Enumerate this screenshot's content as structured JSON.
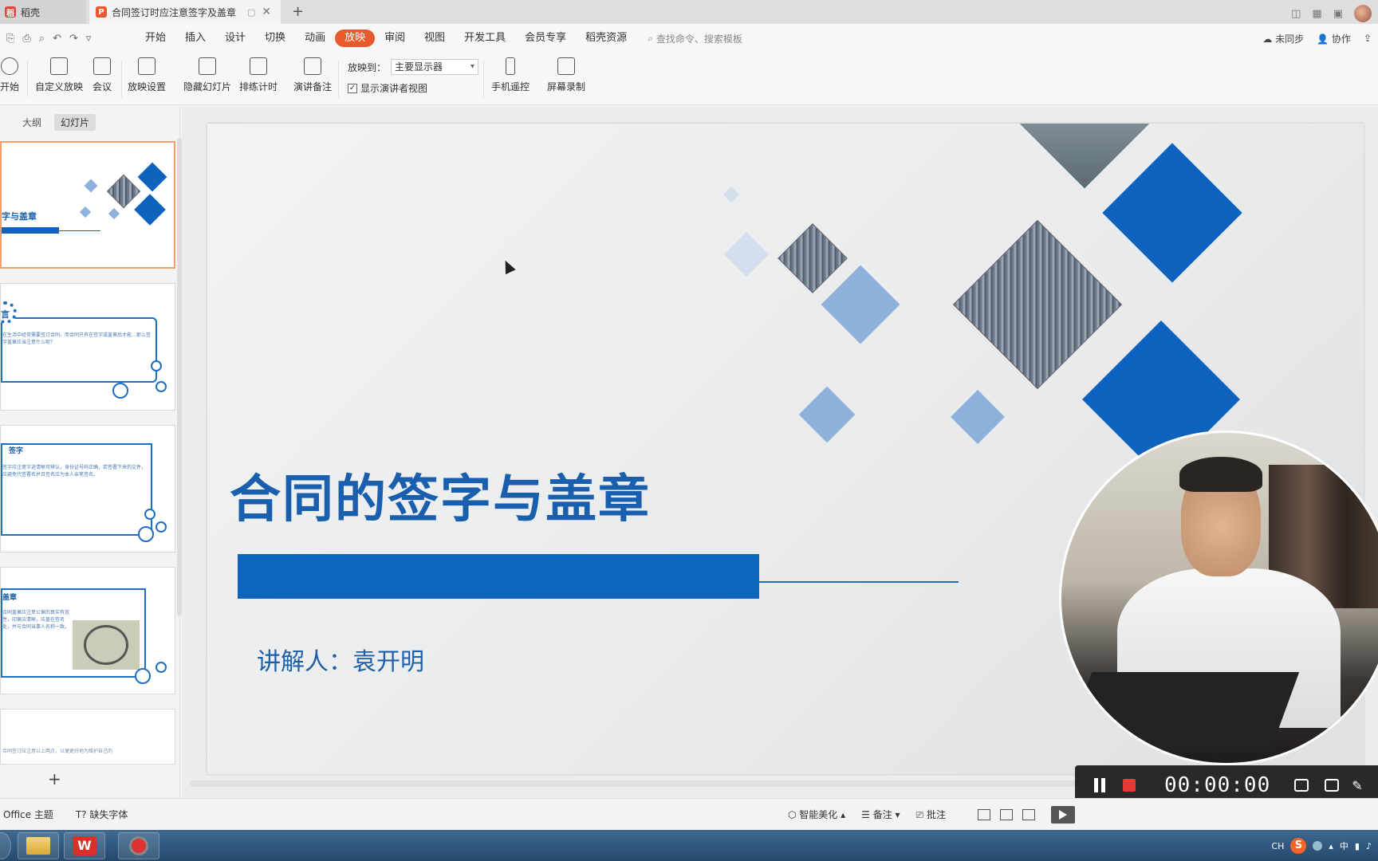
{
  "tabs": [
    {
      "label": "稻壳",
      "active": false
    },
    {
      "label": "合同签订时应注意签字及盖章",
      "active": true
    }
  ],
  "menu": [
    "开始",
    "插入",
    "设计",
    "切换",
    "动画",
    "放映",
    "审阅",
    "视图",
    "开发工具",
    "会员专享",
    "稻壳资源"
  ],
  "menu_active": "放映",
  "search_placeholder": "查找命令、搜索模板",
  "menu_right": {
    "sync": "未同步",
    "collab": "协作"
  },
  "ribbon": {
    "start": "开始",
    "custom_show": "自定义放映",
    "meeting": "会议",
    "show_settings": "放映设置",
    "hide_slide": "隐藏幻灯片",
    "rehearse": "排练计时",
    "notes": "演讲备注",
    "play_to_label": "放映到：",
    "play_to_value": "主要显示器",
    "presenter_view": "显示演讲者视图",
    "presenter_view_checked": true,
    "phone_remote": "手机遥控",
    "screen_record": "屏幕录制"
  },
  "panel_tabs": {
    "outline": "大纲",
    "slides": "幻灯片"
  },
  "thumbs": [
    {
      "title": "字与盖章",
      "text": ""
    },
    {
      "title": "言",
      "text": "在生活中经常需要签订合同，而合同只有在签字或盖章后才能…那么签字盖章应当注意什么呢？"
    },
    {
      "title": "签字",
      "text": "签字应注意字迹清晰可辨认，身份证号码正确，若签署下来的文件，应避免代签署名并且签名应为本人亲笔签名。"
    },
    {
      "title": "盖章",
      "text": "合同盖章应注意公章的真实有效性，印章应清晰，应盖在签名处，并与合同当事人名称一致。"
    },
    {
      "title": "",
      "text": "合同签订应注意以上两点，以便更好地为维护自己的"
    }
  ],
  "slide": {
    "title": "合同的签字与盖章",
    "subtitle": "讲解人：袁开明"
  },
  "recorder": {
    "time": "00:00:00"
  },
  "status": {
    "theme": "Office 主题",
    "missing_font": "缺失字体",
    "beautify": "智能美化",
    "notes": "备注",
    "comments": "批注"
  },
  "tray": {
    "lang": "CH",
    "ime": "中"
  },
  "colors": {
    "accent": "#e8592b",
    "slide_blue": "#0e65bd",
    "title_blue": "#1a5fad"
  }
}
